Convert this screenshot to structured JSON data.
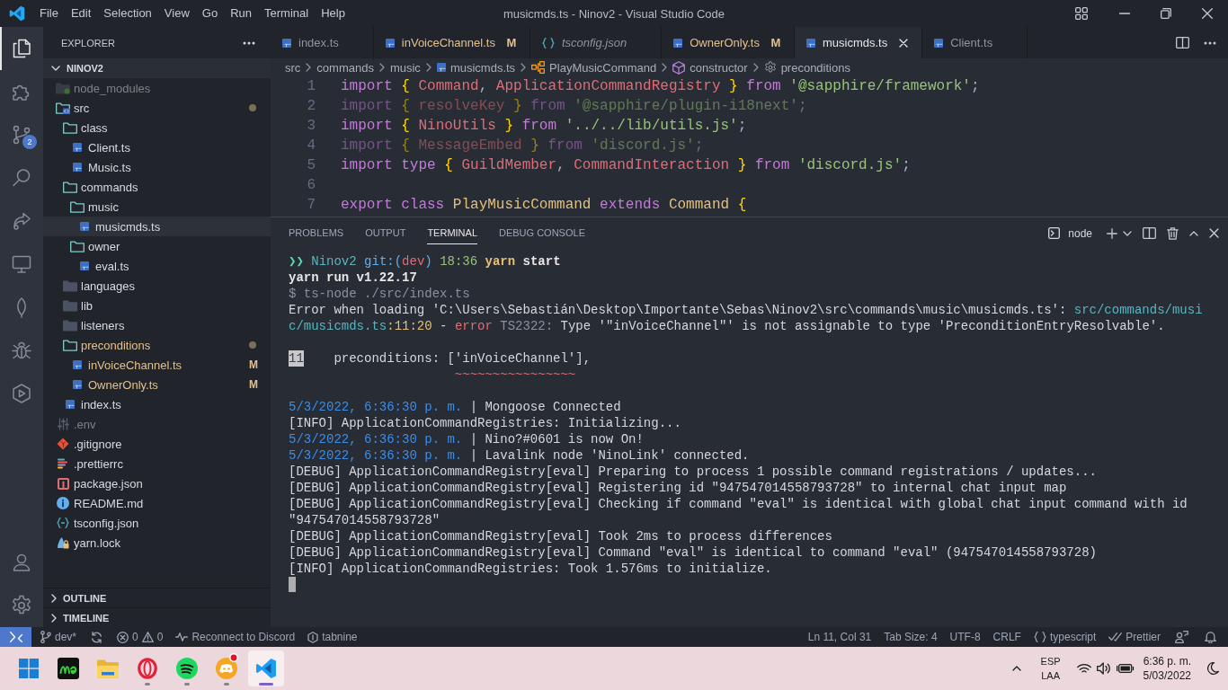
{
  "window": {
    "title": "musicmds.ts - Ninov2 - Visual Studio Code",
    "menu": [
      "File",
      "Edit",
      "Selection",
      "View",
      "Go",
      "Run",
      "Terminal",
      "Help"
    ]
  },
  "activity_bar": {
    "top": [
      {
        "kind": "explorer",
        "selected": true
      },
      {
        "kind": "extensions",
        "selected": false
      },
      {
        "kind": "source-control",
        "selected": false,
        "badge": "2"
      },
      {
        "kind": "search",
        "selected": false
      },
      {
        "kind": "share",
        "selected": false
      },
      {
        "kind": "monitor",
        "selected": false
      },
      {
        "kind": "leaf",
        "selected": false
      },
      {
        "kind": "debug",
        "selected": false
      },
      {
        "kind": "hexagon",
        "selected": false
      }
    ],
    "bottom": [
      {
        "kind": "account",
        "selected": false
      },
      {
        "kind": "settings",
        "selected": false
      }
    ]
  },
  "sidebar": {
    "title": "EXPLORER",
    "folder": {
      "name": "NINOV2",
      "expanded": true,
      "items": [
        {
          "name": "node_modules",
          "kind": "node-folder",
          "expanded": false,
          "selected": false,
          "modified": false,
          "ignored": true,
          "dot": false
        },
        {
          "name": "src",
          "kind": "src-folder",
          "expanded": true,
          "selected": false,
          "modified": false,
          "ignored": false,
          "dot": true,
          "children": [
            {
              "name": "class",
              "kind": "folder",
              "expanded": true,
              "selected": false,
              "modified": false,
              "ignored": false,
              "dot": false,
              "children": [
                {
                  "name": "Client.ts",
                  "kind": "ts",
                  "selected": false,
                  "modified": false,
                  "ignored": false,
                  "dot": false
                },
                {
                  "name": "Music.ts",
                  "kind": "ts",
                  "selected": false,
                  "modified": false,
                  "ignored": false,
                  "dot": false
                }
              ]
            },
            {
              "name": "commands",
              "kind": "folder",
              "expanded": true,
              "selected": false,
              "modified": false,
              "ignored": false,
              "dot": false,
              "children": [
                {
                  "name": "music",
                  "kind": "folder",
                  "expanded": true,
                  "selected": false,
                  "modified": false,
                  "ignored": false,
                  "dot": false,
                  "children": [
                    {
                      "name": "musicmds.ts",
                      "kind": "ts",
                      "selected": true,
                      "modified": false,
                      "ignored": false,
                      "dot": false
                    }
                  ]
                },
                {
                  "name": "owner",
                  "kind": "folder",
                  "expanded": true,
                  "selected": false,
                  "modified": false,
                  "ignored": false,
                  "dot": false,
                  "children": [
                    {
                      "name": "eval.ts",
                      "kind": "ts",
                      "selected": false,
                      "modified": false,
                      "ignored": false,
                      "dot": false
                    }
                  ]
                }
              ]
            },
            {
              "name": "languages",
              "kind": "folder",
              "expanded": false,
              "selected": false,
              "modified": false,
              "ignored": false,
              "dot": false
            },
            {
              "name": "lib",
              "kind": "folder",
              "expanded": false,
              "selected": false,
              "modified": false,
              "ignored": false,
              "dot": false
            },
            {
              "name": "listeners",
              "kind": "folder",
              "expanded": false,
              "selected": false,
              "modified": false,
              "ignored": false,
              "dot": false
            },
            {
              "name": "preconditions",
              "kind": "folder",
              "expanded": true,
              "selected": false,
              "modified": true,
              "ignored": false,
              "dot": true,
              "children": [
                {
                  "name": "inVoiceChannel.ts",
                  "kind": "ts",
                  "selected": false,
                  "modified": true,
                  "ignored": false,
                  "dot": false,
                  "badge": "M"
                },
                {
                  "name": "OwnerOnly.ts",
                  "kind": "ts",
                  "selected": false,
                  "modified": true,
                  "ignored": false,
                  "dot": false,
                  "badge": "M"
                }
              ]
            },
            {
              "name": "index.ts",
              "kind": "ts",
              "selected": false,
              "modified": false,
              "ignored": false,
              "dot": false
            }
          ]
        },
        {
          "name": ".env",
          "kind": "env",
          "selected": false,
          "modified": false,
          "ignored": true,
          "dot": false
        },
        {
          "name": ".gitignore",
          "kind": "git",
          "selected": false,
          "modified": false,
          "ignored": false,
          "dot": false
        },
        {
          "name": ".prettierrc",
          "kind": "prettier",
          "selected": false,
          "modified": false,
          "ignored": false,
          "dot": false
        },
        {
          "name": "package.json",
          "kind": "package",
          "selected": false,
          "modified": false,
          "ignored": false,
          "dot": false
        },
        {
          "name": "README.md",
          "kind": "readme",
          "selected": false,
          "modified": false,
          "ignored": false,
          "dot": false
        },
        {
          "name": "tsconfig.json",
          "kind": "tsconfig",
          "selected": false,
          "modified": false,
          "ignored": false,
          "dot": false
        },
        {
          "name": "yarn.lock",
          "kind": "yarn",
          "selected": false,
          "modified": false,
          "ignored": false,
          "dot": false
        }
      ]
    },
    "sections": [
      {
        "name": "OUTLINE",
        "expanded": false
      },
      {
        "name": "TIMELINE",
        "expanded": false
      }
    ]
  },
  "editor": {
    "tabs": [
      {
        "label": "index.ts",
        "kind": "ts",
        "selected": false,
        "preview": false,
        "modified": false
      },
      {
        "label": "inVoiceChannel.ts",
        "kind": "ts",
        "selected": false,
        "preview": false,
        "modified": true,
        "badge": "M"
      },
      {
        "label": "tsconfig.json",
        "kind": "json",
        "selected": false,
        "preview": true,
        "modified": false
      },
      {
        "label": "OwnerOnly.ts",
        "kind": "ts",
        "selected": false,
        "preview": false,
        "modified": true,
        "badge": "M"
      },
      {
        "label": "musicmds.ts",
        "kind": "ts",
        "selected": true,
        "preview": false,
        "modified": false
      },
      {
        "label": "Client.ts",
        "kind": "ts",
        "selected": false,
        "preview": false,
        "modified": false
      }
    ],
    "breadcrumb": [
      {
        "label": "src",
        "kind": "folder"
      },
      {
        "label": "commands",
        "kind": "folder"
      },
      {
        "label": "music",
        "kind": "folder"
      },
      {
        "label": "musicmds.ts",
        "kind": "ts"
      },
      {
        "label": "PlayMusicCommand",
        "kind": "class"
      },
      {
        "label": "constructor",
        "kind": "constructor"
      },
      {
        "label": "preconditions",
        "kind": "property"
      }
    ],
    "lines": [
      {
        "number": "1",
        "unused": false,
        "tokens": [
          {
            "text": "import ",
            "kind": "keyword"
          },
          {
            "text": "{ ",
            "kind": "brace"
          },
          {
            "text": "Command",
            "kind": "name"
          },
          {
            "text": ", ",
            "kind": "punct"
          },
          {
            "text": "ApplicationCommandRegistry",
            "kind": "name"
          },
          {
            "text": " } ",
            "kind": "brace"
          },
          {
            "text": "from ",
            "kind": "keyword"
          },
          {
            "text": "'@sapphire/framework'",
            "kind": "string"
          },
          {
            "text": ";",
            "kind": "punct"
          }
        ]
      },
      {
        "number": "2",
        "unused": true,
        "tokens": [
          {
            "text": "import ",
            "kind": "keyword"
          },
          {
            "text": "{ ",
            "kind": "brace"
          },
          {
            "text": "resolveKey",
            "kind": "name"
          },
          {
            "text": " } ",
            "kind": "brace"
          },
          {
            "text": "from ",
            "kind": "keyword"
          },
          {
            "text": "'@sapphire/plugin-i18next'",
            "kind": "string"
          },
          {
            "text": ";",
            "kind": "punct"
          }
        ]
      },
      {
        "number": "3",
        "unused": false,
        "tokens": [
          {
            "text": "import ",
            "kind": "keyword"
          },
          {
            "text": "{ ",
            "kind": "brace"
          },
          {
            "text": "NinoUtils",
            "kind": "name"
          },
          {
            "text": " } ",
            "kind": "brace"
          },
          {
            "text": "from ",
            "kind": "keyword"
          },
          {
            "text": "'../../lib/utils.js'",
            "kind": "string"
          },
          {
            "text": ";",
            "kind": "punct"
          }
        ]
      },
      {
        "number": "4",
        "unused": true,
        "tokens": [
          {
            "text": "import ",
            "kind": "keyword"
          },
          {
            "text": "{ ",
            "kind": "brace"
          },
          {
            "text": "MessageEmbed",
            "kind": "name"
          },
          {
            "text": " } ",
            "kind": "brace"
          },
          {
            "text": "from ",
            "kind": "keyword"
          },
          {
            "text": "'discord.js'",
            "kind": "string"
          },
          {
            "text": ";",
            "kind": "punct"
          }
        ]
      },
      {
        "number": "5",
        "unused": false,
        "tokens": [
          {
            "text": "import type ",
            "kind": "keyword"
          },
          {
            "text": "{ ",
            "kind": "brace"
          },
          {
            "text": "GuildMember",
            "kind": "name"
          },
          {
            "text": ", ",
            "kind": "punct"
          },
          {
            "text": "CommandInteraction",
            "kind": "name"
          },
          {
            "text": " } ",
            "kind": "brace"
          },
          {
            "text": "from ",
            "kind": "keyword"
          },
          {
            "text": "'discord.js'",
            "kind": "string"
          },
          {
            "text": ";",
            "kind": "punct"
          }
        ]
      },
      {
        "number": "6"
      },
      {
        "number": "7",
        "unused": false,
        "tokens": [
          {
            "text": "export class ",
            "kind": "keyword"
          },
          {
            "text": "PlayMusicCommand",
            "kind": "class"
          },
          {
            "text": " extends ",
            "kind": "keyword"
          },
          {
            "text": "Command",
            "kind": "class"
          },
          {
            "text": " {",
            "kind": "brace"
          }
        ]
      }
    ]
  },
  "panel": {
    "tabs": [
      {
        "label": "PROBLEMS",
        "selected": false
      },
      {
        "label": "OUTPUT",
        "selected": false
      },
      {
        "label": "TERMINAL",
        "selected": true
      },
      {
        "label": "DEBUG CONSOLE",
        "selected": false
      }
    ],
    "terminal": {
      "name": "node",
      "blocks": [
        {
          "lines": [
            {
              "segments": [
                {
                  "text": "❯❯ ",
                  "kind": "prompt"
                },
                {
                  "text": "Ninov2 ",
                  "kind": "dir"
                },
                {
                  "text": "git:(",
                  "kind": "git"
                },
                {
                  "text": "dev",
                  "kind": "branch"
                },
                {
                  "text": ") ",
                  "kind": "git"
                },
                {
                  "text": "18:36 ",
                  "kind": "time"
                },
                {
                  "text": "yarn",
                  "kind": "command"
                },
                {
                  "text": " start",
                  "kind": "argument"
                }
              ]
            },
            {
              "segments": [
                {
                  "text": "yarn run v1.22.17",
                  "kind": "bold"
                }
              ]
            },
            {
              "segments": [
                {
                  "text": "$ ts-node ./src/index.ts",
                  "kind": "muted"
                }
              ]
            },
            {
              "segments": [
                {
                  "text": "Error when loading 'C:\\Users\\Sebastián\\Desktop\\Importante\\Sebas\\Ninov2\\src\\commands\\music\\musicmds.ts': ",
                  "kind": "text"
                },
                {
                  "text": "src/commands/music/musicmds.ts",
                  "kind": "link"
                },
                {
                  "text": ":",
                  "kind": "number"
                },
                {
                  "text": "11",
                  "kind": "number"
                },
                {
                  "text": ":",
                  "kind": "number"
                },
                {
                  "text": "20",
                  "kind": "number"
                },
                {
                  "text": " - ",
                  "kind": "text"
                },
                {
                  "text": "error",
                  "kind": "error"
                },
                {
                  "text": " TS2322: ",
                  "kind": "code"
                },
                {
                  "text": "Type '\"inVoiceChannel\"' is not assignable to type 'PreconditionEntryResolvable'.",
                  "kind": "text"
                }
              ]
            }
          ]
        },
        {
          "lines": [
            {
              "segments": [
                {
                  "text": "11",
                  "kind": "gutter"
                },
                {
                  "text": "    preconditions: ['inVoiceChannel'],",
                  "kind": "text"
                }
              ]
            },
            {
              "segments": [
                {
                  "text": "                      ~~~~~~~~~~~~~~~~",
                  "kind": "squiggle"
                }
              ]
            }
          ]
        },
        {
          "lines": [
            {
              "segments": [
                {
                  "text": "5/3/2022, 6:36:30 p. m.",
                  "kind": "timestamp"
                },
                {
                  "text": " | Mongoose Connected",
                  "kind": "text"
                }
              ]
            },
            {
              "segments": [
                {
                  "text": "[INFO] ApplicationCommandRegistries: Initializing...",
                  "kind": "text"
                }
              ]
            },
            {
              "segments": [
                {
                  "text": "5/3/2022, 6:36:30 p. m.",
                  "kind": "timestamp"
                },
                {
                  "text": " | Nino?#0601 is now On!",
                  "kind": "text"
                }
              ]
            },
            {
              "segments": [
                {
                  "text": "5/3/2022, 6:36:30 p. m.",
                  "kind": "timestamp"
                },
                {
                  "text": " | Lavalink node 'NinoLink' connected.",
                  "kind": "text"
                }
              ]
            },
            {
              "segments": [
                {
                  "text": "[DEBUG] ApplicationCommandRegistry[eval] Preparing to process 1 possible command registrations / updates...",
                  "kind": "text"
                }
              ]
            },
            {
              "segments": [
                {
                  "text": "[DEBUG] ApplicationCommandRegistry[eval] Registering id \"947547014558793728\" to internal chat input map",
                  "kind": "text"
                }
              ]
            },
            {
              "segments": [
                {
                  "text": "[DEBUG] ApplicationCommandRegistry[eval] Checking if command \"eval\" is identical with global chat input command with id \"947547014558793728\"",
                  "kind": "text"
                }
              ]
            },
            {
              "segments": [
                {
                  "text": "[DEBUG] ApplicationCommandRegistry[eval] Took 2ms to process differences",
                  "kind": "text"
                }
              ]
            },
            {
              "segments": [
                {
                  "text": "[DEBUG] ApplicationCommandRegistry[eval] Command \"eval\" is identical to command \"eval\" (947547014558793728)",
                  "kind": "text"
                }
              ]
            },
            {
              "segments": [
                {
                  "text": "[INFO] ApplicationCommandRegistries: Took 1.576ms to initialize.",
                  "kind": "text"
                }
              ]
            }
          ]
        }
      ]
    }
  },
  "status_bar": {
    "left": [
      {
        "kind": "remote"
      },
      {
        "kind": "branch",
        "text": "dev*"
      },
      {
        "kind": "sync"
      },
      {
        "kind": "problems",
        "errors": "0",
        "warnings": "0"
      },
      {
        "kind": "live",
        "text": "Reconnect to Discord"
      },
      {
        "kind": "assistant",
        "text": "tabnine"
      }
    ],
    "right": [
      {
        "kind": "text",
        "text": "Ln 11, Col 31"
      },
      {
        "kind": "text",
        "text": "Tab Size: 4"
      },
      {
        "kind": "text",
        "text": "UTF-8"
      },
      {
        "kind": "text",
        "text": "CRLF"
      },
      {
        "kind": "language",
        "text": "typescript"
      },
      {
        "kind": "formatter",
        "text": "Prettier"
      },
      {
        "kind": "feedback"
      },
      {
        "kind": "notifications"
      }
    ]
  },
  "taskbar": {
    "apps": [
      {
        "kind": "start",
        "running": false,
        "selected": false,
        "notification": false
      },
      {
        "kind": "scribble",
        "running": false,
        "selected": false,
        "notification": false
      },
      {
        "kind": "files",
        "running": false,
        "selected": false,
        "notification": false
      },
      {
        "kind": "browser",
        "running": true,
        "selected": false,
        "notification": false
      },
      {
        "kind": "music",
        "running": true,
        "selected": false,
        "notification": false
      },
      {
        "kind": "chat",
        "running": true,
        "selected": false,
        "notification": true
      },
      {
        "kind": "editor",
        "running": true,
        "selected": true,
        "notification": false
      }
    ],
    "tray": {
      "language": "ESP",
      "layout": "LAA",
      "time": "6:36 p. m.",
      "date": "5/03/2022"
    }
  }
}
